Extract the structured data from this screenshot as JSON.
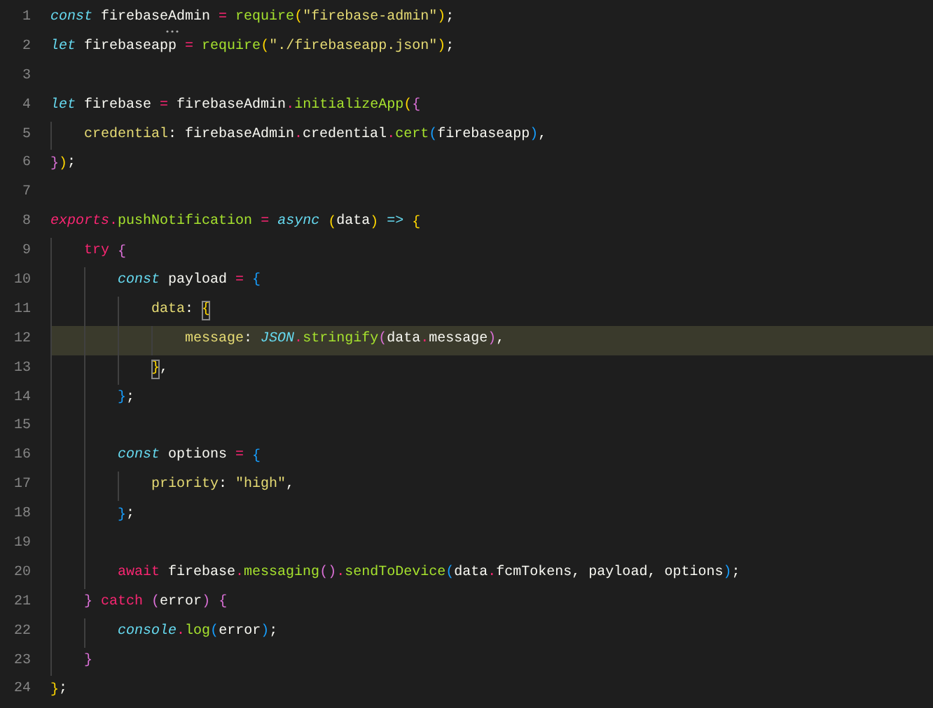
{
  "editor": {
    "lines": [
      {
        "number": "1",
        "current": false,
        "hint": true,
        "tokens": [
          {
            "text": "const ",
            "kind": "storage"
          },
          {
            "text": "firebaseAdmin ",
            "kind": "plain"
          },
          {
            "text": "= ",
            "kind": "operator"
          },
          {
            "text": "require",
            "kind": "function"
          },
          {
            "text": "(",
            "kind": "bracket",
            "color": "#ffd700",
            "matched": false
          },
          {
            "text": "\"firebase-admin\"",
            "kind": "string"
          },
          {
            "text": ")",
            "kind": "bracket",
            "color": "#ffd700",
            "matched": false
          },
          {
            "text": ";",
            "kind": "plain"
          }
        ]
      },
      {
        "number": "2",
        "current": false,
        "hint": false,
        "tokens": [
          {
            "text": "let ",
            "kind": "storage"
          },
          {
            "text": "firebaseapp ",
            "kind": "plain"
          },
          {
            "text": "= ",
            "kind": "operator"
          },
          {
            "text": "require",
            "kind": "function"
          },
          {
            "text": "(",
            "kind": "bracket",
            "color": "#ffd700",
            "matched": false
          },
          {
            "text": "\"./firebaseapp.json\"",
            "kind": "string"
          },
          {
            "text": ")",
            "kind": "bracket",
            "color": "#ffd700",
            "matched": false
          },
          {
            "text": ";",
            "kind": "plain"
          }
        ]
      },
      {
        "number": "3",
        "current": false,
        "hint": false
      },
      {
        "number": "4",
        "current": false,
        "hint": false,
        "tokens": [
          {
            "text": "let ",
            "kind": "storage"
          },
          {
            "text": "firebase ",
            "kind": "plain"
          },
          {
            "text": "= ",
            "kind": "operator"
          },
          {
            "text": "firebaseAdmin",
            "kind": "plain"
          },
          {
            "text": ".",
            "kind": "operator"
          },
          {
            "text": "initializeApp",
            "kind": "function"
          },
          {
            "text": "(",
            "kind": "bracket",
            "color": "#ffd700",
            "matched": false
          },
          {
            "text": "{",
            "kind": "bracket",
            "color": "#da70d6",
            "matched": false
          }
        ],
        "children": [
          {
            "number": "5",
            "current": false,
            "hint": false,
            "tokens": [
              {
                "text": "credential",
                "kind": "property"
              },
              {
                "text": ": firebaseAdmin",
                "kind": "plain"
              },
              {
                "text": ".",
                "kind": "operator"
              },
              {
                "text": "credential",
                "kind": "plain"
              },
              {
                "text": ".",
                "kind": "operator"
              },
              {
                "text": "cert",
                "kind": "function"
              },
              {
                "text": "(",
                "kind": "bracket",
                "color": "#179fff",
                "matched": false
              },
              {
                "text": "firebaseapp",
                "kind": "plain"
              },
              {
                "text": ")",
                "kind": "bracket",
                "color": "#179fff",
                "matched": false
              },
              {
                "text": ",",
                "kind": "plain"
              }
            ]
          }
        ]
      },
      {
        "number": "6",
        "current": false,
        "hint": false,
        "tokens": [
          {
            "text": "}",
            "kind": "bracket",
            "color": "#da70d6",
            "matched": false
          },
          {
            "text": ")",
            "kind": "bracket",
            "color": "#ffd700",
            "matched": false
          },
          {
            "text": ";",
            "kind": "plain"
          }
        ]
      },
      {
        "number": "7",
        "current": false,
        "hint": false
      },
      {
        "number": "8",
        "current": false,
        "hint": false,
        "tokens": [
          {
            "text": "exports",
            "kind": "variable"
          },
          {
            "text": ".",
            "kind": "operator"
          },
          {
            "text": "pushNotification ",
            "kind": "function"
          },
          {
            "text": "= ",
            "kind": "operator"
          },
          {
            "text": "async ",
            "kind": "storage"
          },
          {
            "text": "(",
            "kind": "bracket",
            "color": "#ffd700",
            "matched": false
          },
          {
            "text": "data",
            "kind": "plain"
          },
          {
            "text": ") ",
            "kind": "bracket",
            "color": "#ffd700",
            "matched": false
          },
          {
            "text": "=> ",
            "kind": "arrow"
          },
          {
            "text": "{",
            "kind": "bracket",
            "color": "#ffd700",
            "matched": false
          }
        ],
        "children": [
          {
            "number": "9",
            "current": false,
            "hint": false,
            "tokens": [
              {
                "text": "try ",
                "kind": "control"
              },
              {
                "text": "{",
                "kind": "bracket",
                "color": "#da70d6",
                "matched": false
              }
            ],
            "children": [
              {
                "number": "10",
                "current": false,
                "hint": false,
                "tokens": [
                  {
                    "text": "const ",
                    "kind": "storage"
                  },
                  {
                    "text": "payload ",
                    "kind": "plain"
                  },
                  {
                    "text": "= ",
                    "kind": "operator"
                  },
                  {
                    "text": "{",
                    "kind": "bracket",
                    "color": "#179fff",
                    "matched": false
                  }
                ],
                "children": [
                  {
                    "number": "11",
                    "current": false,
                    "hint": false,
                    "tokens": [
                      {
                        "text": "data",
                        "kind": "property"
                      },
                      {
                        "text": ": ",
                        "kind": "plain"
                      },
                      {
                        "text": "{",
                        "kind": "bracket",
                        "color": "#ffd700",
                        "matched": true
                      }
                    ],
                    "children": [
                      {
                        "number": "12",
                        "current": true,
                        "hint": false,
                        "tokens": [
                          {
                            "text": "message",
                            "kind": "property"
                          },
                          {
                            "text": ": ",
                            "kind": "plain"
                          },
                          {
                            "text": "JSON",
                            "kind": "storage"
                          },
                          {
                            "text": ".",
                            "kind": "operator"
                          },
                          {
                            "text": "stringify",
                            "kind": "function"
                          },
                          {
                            "text": "(",
                            "kind": "bracket",
                            "color": "#da70d6",
                            "matched": false
                          },
                          {
                            "text": "data",
                            "kind": "plain"
                          },
                          {
                            "text": ".",
                            "kind": "operator"
                          },
                          {
                            "text": "message",
                            "kind": "plain"
                          },
                          {
                            "text": ")",
                            "kind": "bracket",
                            "color": "#da70d6",
                            "matched": false
                          },
                          {
                            "text": ",",
                            "kind": "plain"
                          }
                        ]
                      }
                    ]
                  },
                  {
                    "number": "13",
                    "current": false,
                    "hint": false,
                    "tokens": [
                      {
                        "text": "}",
                        "kind": "bracket",
                        "color": "#ffd700",
                        "matched": true
                      },
                      {
                        "text": ",",
                        "kind": "plain"
                      }
                    ]
                  }
                ]
              },
              {
                "number": "14",
                "current": false,
                "hint": false,
                "tokens": [
                  {
                    "text": "}",
                    "kind": "bracket",
                    "color": "#179fff",
                    "matched": false
                  },
                  {
                    "text": ";",
                    "kind": "plain"
                  }
                ]
              },
              {
                "number": "15",
                "current": false,
                "hint": false
              },
              {
                "number": "16",
                "current": false,
                "hint": false,
                "tokens": [
                  {
                    "text": "const ",
                    "kind": "storage"
                  },
                  {
                    "text": "options ",
                    "kind": "plain"
                  },
                  {
                    "text": "= ",
                    "kind": "operator"
                  },
                  {
                    "text": "{",
                    "kind": "bracket",
                    "color": "#179fff",
                    "matched": false
                  }
                ],
                "children": [
                  {
                    "number": "17",
                    "current": false,
                    "hint": false,
                    "tokens": [
                      {
                        "text": "priority",
                        "kind": "property"
                      },
                      {
                        "text": ": ",
                        "kind": "plain"
                      },
                      {
                        "text": "\"high\"",
                        "kind": "string"
                      },
                      {
                        "text": ",",
                        "kind": "plain"
                      }
                    ]
                  }
                ]
              },
              {
                "number": "18",
                "current": false,
                "hint": false,
                "tokens": [
                  {
                    "text": "}",
                    "kind": "bracket",
                    "color": "#179fff",
                    "matched": false
                  },
                  {
                    "text": ";",
                    "kind": "plain"
                  }
                ]
              },
              {
                "number": "19",
                "current": false,
                "hint": false
              },
              {
                "number": "20",
                "current": false,
                "hint": false,
                "tokens": [
                  {
                    "text": "await ",
                    "kind": "control"
                  },
                  {
                    "text": "firebase",
                    "kind": "plain"
                  },
                  {
                    "text": ".",
                    "kind": "operator"
                  },
                  {
                    "text": "messaging",
                    "kind": "function"
                  },
                  {
                    "text": "(",
                    "kind": "bracket",
                    "color": "#da70d6",
                    "matched": false
                  },
                  {
                    "text": ")",
                    "kind": "bracket",
                    "color": "#da70d6",
                    "matched": false
                  },
                  {
                    "text": ".",
                    "kind": "operator"
                  },
                  {
                    "text": "sendToDevice",
                    "kind": "function"
                  },
                  {
                    "text": "(",
                    "kind": "bracket",
                    "color": "#179fff",
                    "matched": false
                  },
                  {
                    "text": "data",
                    "kind": "plain"
                  },
                  {
                    "text": ".",
                    "kind": "operator"
                  },
                  {
                    "text": "fcmTokens, payload, options",
                    "kind": "plain"
                  },
                  {
                    "text": ")",
                    "kind": "bracket",
                    "color": "#179fff",
                    "matched": false
                  },
                  {
                    "text": ";",
                    "kind": "plain"
                  }
                ]
              }
            ]
          },
          {
            "number": "21",
            "current": false,
            "hint": false,
            "tokens": [
              {
                "text": "} ",
                "kind": "bracket",
                "color": "#da70d6",
                "matched": false
              },
              {
                "text": "catch ",
                "kind": "control"
              },
              {
                "text": "(",
                "kind": "bracket",
                "color": "#da70d6",
                "matched": false
              },
              {
                "text": "error",
                "kind": "plain"
              },
              {
                "text": ") ",
                "kind": "bracket",
                "color": "#da70d6",
                "matched": false
              },
              {
                "text": "{",
                "kind": "bracket",
                "color": "#da70d6",
                "matched": false
              }
            ],
            "children": [
              {
                "number": "22",
                "current": false,
                "hint": false,
                "tokens": [
                  {
                    "text": "console",
                    "kind": "storage"
                  },
                  {
                    "text": ".",
                    "kind": "operator"
                  },
                  {
                    "text": "log",
                    "kind": "function"
                  },
                  {
                    "text": "(",
                    "kind": "bracket",
                    "color": "#179fff",
                    "matched": false
                  },
                  {
                    "text": "error",
                    "kind": "plain"
                  },
                  {
                    "text": ")",
                    "kind": "bracket",
                    "color": "#179fff",
                    "matched": false
                  },
                  {
                    "text": ";",
                    "kind": "plain"
                  }
                ]
              }
            ]
          },
          {
            "number": "23",
            "current": false,
            "hint": false,
            "tokens": [
              {
                "text": "}",
                "kind": "bracket",
                "color": "#da70d6",
                "matched": false
              }
            ]
          }
        ]
      },
      {
        "number": "24",
        "current": false,
        "hint": false,
        "tokens": [
          {
            "text": "}",
            "kind": "bracket",
            "color": "#ffd700",
            "matched": false
          },
          {
            "text": ";",
            "kind": "plain"
          }
        ]
      }
    ]
  }
}
